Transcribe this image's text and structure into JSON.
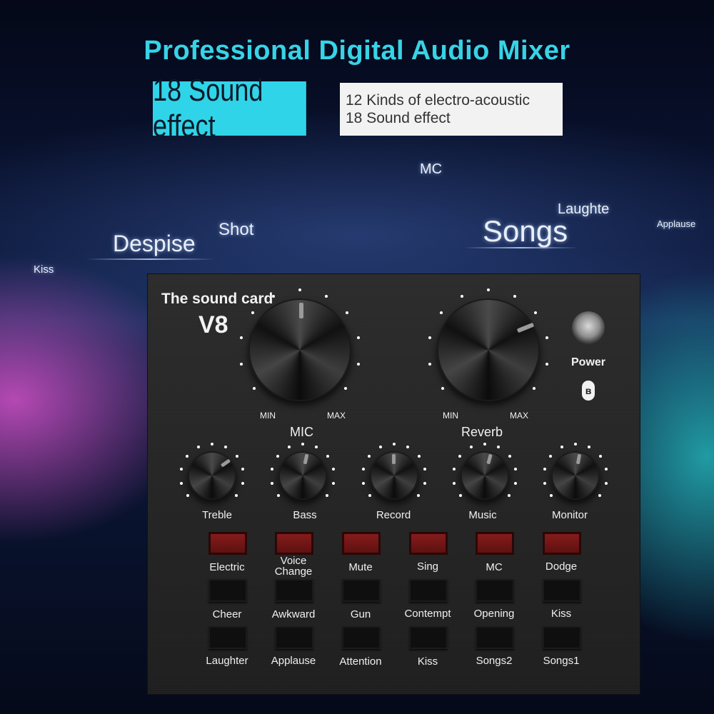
{
  "headline": "Professional Digital Audio Mixer",
  "banner": {
    "badge": "18 Sound effect",
    "line1": "12 Kinds of electro-acoustic",
    "line2": "18 Sound effect"
  },
  "floating_words": {
    "mc": "MC",
    "laughte": "Laughte",
    "applause": "Applause",
    "shot": "Shot",
    "despise": "Despise",
    "songs": "Songs",
    "kiss": "Kiss"
  },
  "device": {
    "brand": "The sound card",
    "model": "V8",
    "power_label": "Power",
    "bluetooth_symbol": "ʙ",
    "mic_knob": {
      "label": "MIC",
      "min": "MIN",
      "max": "MAX"
    },
    "reverb_knob": {
      "label": "Reverb",
      "min": "MIN",
      "max": "MAX"
    },
    "small_knobs": [
      "Treble",
      "Bass",
      "Record",
      "Music",
      "Monitor"
    ],
    "button_rows": [
      [
        "Electric",
        "Voice\nChange",
        "Mute",
        "Sing",
        "MC",
        "Dodge"
      ],
      [
        "Cheer",
        "Awkward",
        "Gun",
        "Contempt",
        "Opening",
        "Kiss"
      ],
      [
        "Laughter",
        "Applause",
        "Attention",
        "Kiss",
        "Songs2",
        "Songs1"
      ]
    ]
  },
  "colors": {
    "accent_cyan": "#30d4e8",
    "device_body": "#262626",
    "red_button": "#6a1414"
  }
}
